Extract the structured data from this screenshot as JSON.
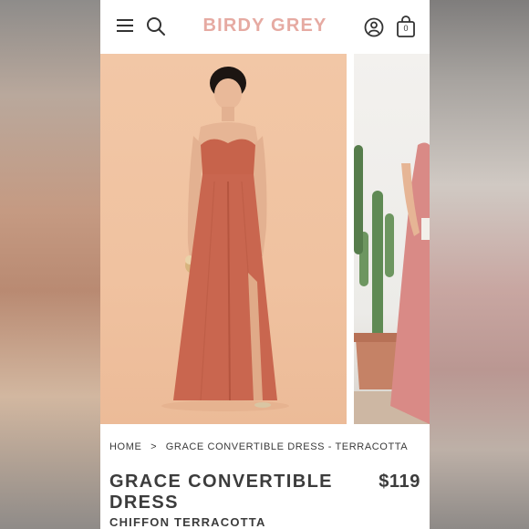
{
  "header": {
    "brand": "BIRDY GREY",
    "cart_count": "0",
    "icons": [
      "menu-icon",
      "search-icon",
      "account-icon",
      "bag-icon"
    ]
  },
  "breadcrumb": {
    "home": "HOME",
    "separator": ">",
    "current": "GRACE CONVERTIBLE DRESS - TERRACOTTA"
  },
  "product": {
    "name": "GRACE CONVERTIBLE DRESS",
    "price": "$119",
    "fabric_color": "CHIFFON TERRACOTTA"
  },
  "colors": {
    "brand": "#e6aaa2",
    "dress": "#c9664f",
    "backdrop": "#f2c7a6",
    "text": "#3c3c3c"
  }
}
